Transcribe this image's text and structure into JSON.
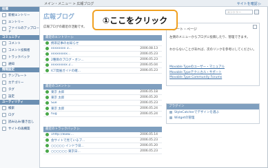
{
  "topbar": {
    "breadcrumb": "メイン・メニュー > 広報ブログ",
    "view_site": "サイトを確認 ▷"
  },
  "sidebar": {
    "sections": [
      {
        "title": "投稿",
        "items": [
          "新規エントリー",
          "エントリー",
          "ファイルのアップロード"
        ]
      },
      {
        "title": "コミュニティ",
        "items": [
          "コメント",
          "コメント投稿者",
          "トラックバック",
          "通知"
        ]
      },
      {
        "title": "情報設定",
        "items": [
          "テンプレート",
          "カテゴリー",
          "タグ",
          "設定"
        ]
      },
      {
        "title": "ユーティリティ",
        "items": [
          "検索",
          "ログ",
          "読み込み/書き出し",
          "サイトの再構築"
        ]
      }
    ]
  },
  "main": {
    "title": "広報ブログ",
    "description": "広報ブログの最近の活動です。",
    "callout": "①ここをクリック",
    "search_placeholder": "エントリー",
    "panels": [
      {
        "header": "最近のエントリー ▷",
        "rows": [
          {
            "title": "携帯記事のお知らせ",
            "date": ""
          },
          {
            "title": "xxxxxxxx 3...",
            "date": "2006.08.13"
          },
          {
            "title": "xxxxxxxxx...",
            "date": "2006.05.23"
          },
          {
            "title": "2種目のブログ・オン...",
            "date": "2006.05.23"
          },
          {
            "title": "xxxxxxxxx 2...",
            "date": "2006.05.04"
          },
          {
            "title": "ICT発展ガイドの確...",
            "date": "2006.05.23"
          }
        ]
      },
      {
        "header": "最近のコメント ▷",
        "rows": [
          {
            "title": "東京 太郎",
            "date": "2006.05.18"
          },
          {
            "title": "東京 太郎",
            "date": "2006.05.20"
          },
          {
            "title": "Sue",
            "date": "2006.05.23"
          },
          {
            "title": "東京 太郎",
            "date": "2006.05.24"
          },
          {
            "title": "hug",
            "date": "2006.05.24"
          }
        ]
      },
      {
        "header": "最近のトラックバック ▷",
        "rows": [
          {
            "title": "1http://www....",
            "date": "2006.05.14"
          },
          {
            "title": "会サイトで見ているブ...",
            "date": "2006.05.23"
          },
          {
            "title": "○○○○○ インドラ日...",
            "date": "2006.05.20"
          },
          {
            "title": "○○○○○○ 東京日...",
            "date": "2006.05.23"
          }
        ]
      }
    ]
  },
  "start_page": {
    "title": "スタート・ページ",
    "p1": "左側のメニューからブログに投稿したり、管理できます。",
    "p2": "わからないことがあれば、次のリンクを参考にしてください。",
    "links": [
      "Movable Typeのユーザー・マニュアル",
      "Movable Typeテクニカル・サポート",
      "Movable Type Community Forums"
    ]
  },
  "plugins": {
    "header": "プラグイン",
    "items": [
      "StyleCatcherでデザインを選ぶ",
      "Widgetの管理"
    ]
  }
}
